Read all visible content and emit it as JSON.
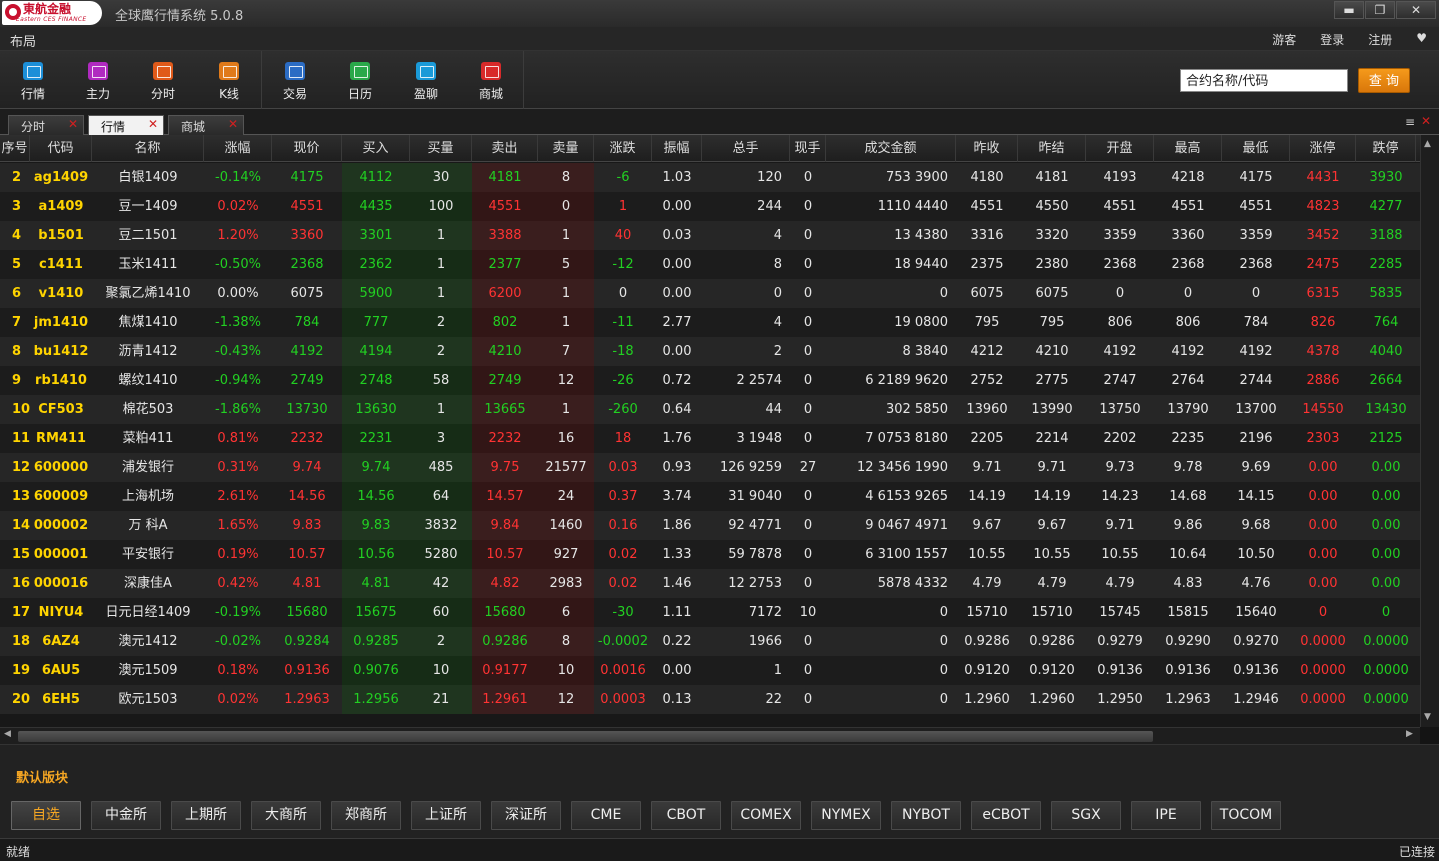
{
  "window": {
    "logo_text": "東航金融",
    "logo_sub": "Eastern CES FINANCE",
    "title": "全球鹰行情系统 5.0.8",
    "controls": [
      "▬",
      "❐",
      "✕"
    ]
  },
  "menubar": {
    "layout": "布局",
    "right_items": [
      "游客",
      "登录",
      "注册",
      "♥"
    ]
  },
  "toolbar": {
    "buttons": [
      {
        "label": "行情",
        "icon": "market-chart-icon",
        "color": "#1c8fd8"
      },
      {
        "label": "主力",
        "icon": "eye-icon",
        "color": "#b02ac0"
      },
      {
        "label": "分时",
        "icon": "line-chart-icon",
        "color": "#e05a1a"
      },
      {
        "label": "K线",
        "icon": "candlestick-icon",
        "color": "#e07a1a"
      },
      {
        "label": "交易",
        "icon": "ctp-trade-icon",
        "color": "#2b6cc4"
      },
      {
        "label": "日历",
        "icon": "calendar-icon",
        "color": "#2aa84a"
      },
      {
        "label": "盈聊",
        "icon": "chat-bubble-icon",
        "color": "#1a9ad8"
      },
      {
        "label": "商城",
        "icon": "shop-icon",
        "color": "#d82a2a"
      }
    ],
    "search_placeholder": "合约名称/代码",
    "query_label": "查 询"
  },
  "tabs": [
    {
      "label": "分时",
      "active": false
    },
    {
      "label": "行情",
      "active": true
    },
    {
      "label": "商城",
      "active": false
    }
  ],
  "tab_menu_icon": "≡",
  "tab_close_icon": "✕",
  "table": {
    "columns": [
      "序号",
      "代码",
      "名称",
      "涨幅",
      "现价",
      "买入",
      "买量",
      "卖出",
      "卖量",
      "涨跌",
      "振幅",
      "总手",
      "现手",
      "成交金额",
      "昨收",
      "昨结",
      "开盘",
      "最高",
      "最低",
      "涨停",
      "跌停"
    ],
    "rows": [
      [
        "2",
        "ag1409",
        "白银1409",
        "-0.14%",
        "4175",
        "4112",
        "30",
        "4181",
        "8",
        "-6",
        "1.03",
        "120",
        "0",
        "753 3900",
        "4180",
        "4181",
        "4193",
        "4218",
        "4175",
        "4431",
        "3930"
      ],
      [
        "3",
        "a1409",
        "豆一1409",
        "0.02%",
        "4551",
        "4435",
        "100",
        "4551",
        "0",
        "1",
        "0.00",
        "244",
        "0",
        "1110 4440",
        "4551",
        "4550",
        "4551",
        "4551",
        "4551",
        "4823",
        "4277"
      ],
      [
        "4",
        "b1501",
        "豆二1501",
        "1.20%",
        "3360",
        "3301",
        "1",
        "3388",
        "1",
        "40",
        "0.03",
        "4",
        "0",
        "13 4380",
        "3316",
        "3320",
        "3359",
        "3360",
        "3359",
        "3452",
        "3188"
      ],
      [
        "5",
        "c1411",
        "玉米1411",
        "-0.50%",
        "2368",
        "2362",
        "1",
        "2377",
        "5",
        "-12",
        "0.00",
        "8",
        "0",
        "18 9440",
        "2375",
        "2380",
        "2368",
        "2368",
        "2368",
        "2475",
        "2285"
      ],
      [
        "6",
        "v1410",
        "聚氯乙烯1410",
        "0.00%",
        "6075",
        "5900",
        "1",
        "6200",
        "1",
        "0",
        "0.00",
        "0",
        "0",
        "0",
        "6075",
        "6075",
        "0",
        "0",
        "0",
        "6315",
        "5835"
      ],
      [
        "7",
        "jm1410",
        "焦煤1410",
        "-1.38%",
        "784",
        "777",
        "2",
        "802",
        "1",
        "-11",
        "2.77",
        "4",
        "0",
        "19 0800",
        "795",
        "795",
        "806",
        "806",
        "784",
        "826",
        "764"
      ],
      [
        "8",
        "bu1412",
        "沥青1412",
        "-0.43%",
        "4192",
        "4194",
        "2",
        "4210",
        "7",
        "-18",
        "0.00",
        "2",
        "0",
        "8 3840",
        "4212",
        "4210",
        "4192",
        "4192",
        "4192",
        "4378",
        "4040"
      ],
      [
        "9",
        "rb1410",
        "螺纹1410",
        "-0.94%",
        "2749",
        "2748",
        "58",
        "2749",
        "12",
        "-26",
        "0.72",
        "2 2574",
        "0",
        "6 2189 9620",
        "2752",
        "2775",
        "2747",
        "2764",
        "2744",
        "2886",
        "2664"
      ],
      [
        "10",
        "CF503",
        "棉花503",
        "-1.86%",
        "13730",
        "13630",
        "1",
        "13665",
        "1",
        "-260",
        "0.64",
        "44",
        "0",
        "302 5850",
        "13960",
        "13990",
        "13750",
        "13790",
        "13700",
        "14550",
        "13430"
      ],
      [
        "11",
        "RM411",
        "菜粕411",
        "0.81%",
        "2232",
        "2231",
        "3",
        "2232",
        "16",
        "18",
        "1.76",
        "3 1948",
        "0",
        "7 0753 8180",
        "2205",
        "2214",
        "2202",
        "2235",
        "2196",
        "2303",
        "2125"
      ],
      [
        "12",
        "600000",
        "浦发银行",
        "0.31%",
        "9.74",
        "9.74",
        "485",
        "9.75",
        "21577",
        "0.03",
        "0.93",
        "126 9259",
        "27",
        "12 3456 1990",
        "9.71",
        "9.71",
        "9.73",
        "9.78",
        "9.69",
        "0.00",
        "0.00"
      ],
      [
        "13",
        "600009",
        "上海机场",
        "2.61%",
        "14.56",
        "14.56",
        "64",
        "14.57",
        "24",
        "0.37",
        "3.74",
        "31 9040",
        "0",
        "4 6153 9265",
        "14.19",
        "14.19",
        "14.23",
        "14.68",
        "14.15",
        "0.00",
        "0.00"
      ],
      [
        "14",
        "000002",
        "万  科A",
        "1.65%",
        "9.83",
        "9.83",
        "3832",
        "9.84",
        "1460",
        "0.16",
        "1.86",
        "92 4771",
        "0",
        "9 0467 4971",
        "9.67",
        "9.67",
        "9.71",
        "9.86",
        "9.68",
        "0.00",
        "0.00"
      ],
      [
        "15",
        "000001",
        "平安银行",
        "0.19%",
        "10.57",
        "10.56",
        "5280",
        "10.57",
        "927",
        "0.02",
        "1.33",
        "59 7878",
        "0",
        "6 3100 1557",
        "10.55",
        "10.55",
        "10.55",
        "10.64",
        "10.50",
        "0.00",
        "0.00"
      ],
      [
        "16",
        "000016",
        "深康佳A",
        "0.42%",
        "4.81",
        "4.81",
        "42",
        "4.82",
        "2983",
        "0.02",
        "1.46",
        "12 2753",
        "0",
        "5878 4332",
        "4.79",
        "4.79",
        "4.79",
        "4.83",
        "4.76",
        "0.00",
        "0.00"
      ],
      [
        "17",
        "NIYU4",
        "日元日经1409",
        "-0.19%",
        "15680",
        "15675",
        "60",
        "15680",
        "6",
        "-30",
        "1.11",
        "7172",
        "10",
        "0",
        "15710",
        "15710",
        "15745",
        "15815",
        "15640",
        "0",
        "0"
      ],
      [
        "18",
        "6AZ4",
        "澳元1412",
        "-0.02%",
        "0.9284",
        "0.9285",
        "2",
        "0.9286",
        "8",
        "-0.0002",
        "0.22",
        "1966",
        "0",
        "0",
        "0.9286",
        "0.9286",
        "0.9279",
        "0.9290",
        "0.9270",
        "0.0000",
        "0.0000"
      ],
      [
        "19",
        "6AU5",
        "澳元1509",
        "0.18%",
        "0.9136",
        "0.9076",
        "10",
        "0.9177",
        "10",
        "0.0016",
        "0.00",
        "1",
        "0",
        "0",
        "0.9120",
        "0.9120",
        "0.9136",
        "0.9136",
        "0.9136",
        "0.0000",
        "0.0000"
      ],
      [
        "20",
        "6EH5",
        "欧元1503",
        "0.02%",
        "1.2963",
        "1.2956",
        "21",
        "1.2961",
        "12",
        "0.0003",
        "0.13",
        "22",
        "0",
        "0",
        "1.2960",
        "1.2960",
        "1.2950",
        "1.2963",
        "1.2946",
        "0.0000",
        "0.0000"
      ]
    ],
    "colors": {
      "code": "#ffd400",
      "up": "#ff3333",
      "down": "#22d022",
      "neutral": "#e6e6e6"
    }
  },
  "bottom": {
    "default_sector": "默认版块",
    "markets": [
      "自选",
      "中金所",
      "上期所",
      "大商所",
      "郑商所",
      "上证所",
      "深证所",
      "CME",
      "CBOT",
      "COMEX",
      "NYMEX",
      "NYBOT",
      "eCBOT",
      "SGX",
      "IPE",
      "TOCOM"
    ],
    "active_market": "自选"
  },
  "status": {
    "left": "就绪",
    "right": "已连接"
  }
}
